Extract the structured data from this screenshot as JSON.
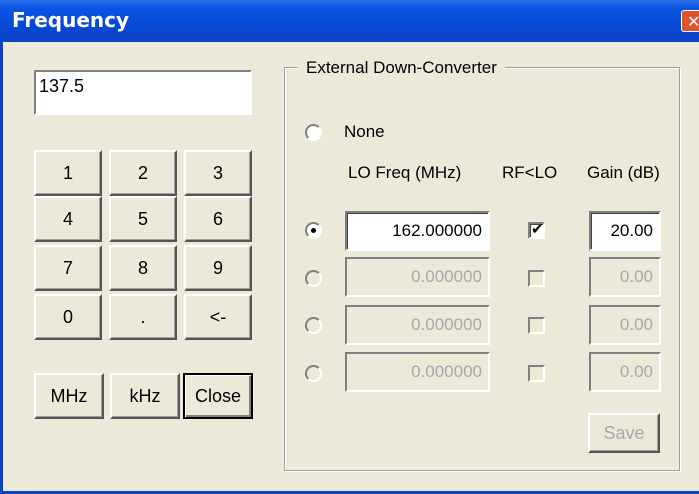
{
  "window": {
    "title": "Frequency",
    "close_glyph": "✕"
  },
  "frequency": {
    "value": "137.5"
  },
  "keypad": [
    "1",
    "2",
    "3",
    "4",
    "5",
    "6",
    "7",
    "8",
    "9",
    "0",
    ".",
    "<-"
  ],
  "units": {
    "mhz": "MHz",
    "khz": "kHz",
    "close": "Close"
  },
  "converter": {
    "group_label": "External Down-Converter",
    "none_label": "None",
    "headers": {
      "lo_freq": "LO Freq (MHz)",
      "rf_lo": "RF<LO",
      "gain": "Gain (dB)"
    },
    "rows": [
      {
        "selected": true,
        "enabled": true,
        "lo_freq": "162.000000",
        "rf_lt_lo": true,
        "gain": "20.00"
      },
      {
        "selected": false,
        "enabled": false,
        "lo_freq": "0.000000",
        "rf_lt_lo": false,
        "gain": "0.00"
      },
      {
        "selected": false,
        "enabled": false,
        "lo_freq": "0.000000",
        "rf_lt_lo": false,
        "gain": "0.00"
      },
      {
        "selected": false,
        "enabled": false,
        "lo_freq": "0.000000",
        "rf_lt_lo": false,
        "gain": "0.00"
      }
    ],
    "save_label": "Save",
    "check_glyph": "✔"
  }
}
